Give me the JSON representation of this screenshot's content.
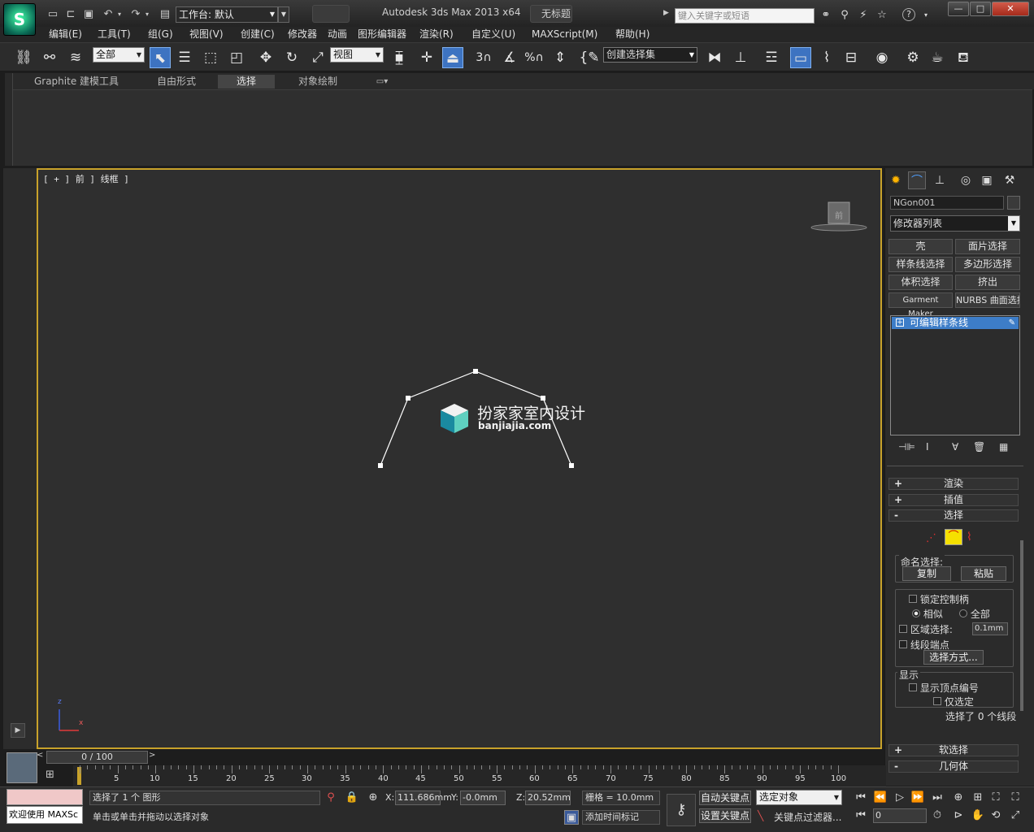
{
  "titlebar": {
    "workspace": "工作台: 默认",
    "app_title": "Autodesk 3ds Max  2013 x64",
    "file_title": "无标题",
    "search_placeholder": "键入关键字或短语",
    "min_label": "—",
    "max_label": "□",
    "close_label": "✕"
  },
  "menubar": {
    "items": [
      "编辑(E)",
      "工具(T)",
      "组(G)",
      "视图(V)",
      "创建(C)",
      "修改器",
      "动画",
      "图形编辑器",
      "渲染(R)",
      "自定义(U)",
      "MAXScript(M)",
      "帮助(H)"
    ]
  },
  "toolbar": {
    "filter_select": "全部",
    "ref_coord": "视图",
    "named_selection": "创建选择集"
  },
  "ribbon": {
    "tabs": [
      "Graphite 建模工具",
      "自由形式",
      "选择",
      "对象绘制"
    ],
    "active_tab": "选择"
  },
  "viewport": {
    "label": "[ + ] 前 ] 线框 ]",
    "viewcube_label": "前",
    "watermark_title": "扮家家室内设计",
    "watermark_url": "banjiajia.com",
    "axis_z": "z",
    "axis_x": "x"
  },
  "command_panel": {
    "object_name": "NGon001",
    "modifier_list": "修改器列表",
    "modifier_buttons": [
      [
        "壳",
        "面片选择"
      ],
      [
        "样条线选择",
        "多边形选择"
      ],
      [
        "体积选择",
        "挤出"
      ],
      [
        "Garment Maker",
        "NURBS 曲面选择"
      ]
    ],
    "stack_item": "可编辑样条线",
    "rollouts": {
      "render": "渲染",
      "interp": "插值",
      "selection": "选择",
      "soft_sel": "软选择",
      "geometry": "几何体"
    },
    "named_sel_label": "命名选择:",
    "copy": "复制",
    "paste": "粘贴",
    "lock_handles": "锁定控制柄",
    "similar": "相似",
    "all": "全部",
    "area_sel": "区域选择:",
    "area_val": "0.1mm",
    "seg_end": "线段端点",
    "select_by": "选择方式...",
    "display": "显示",
    "show_vert_num": "显示顶点编号",
    "selected_only": "仅选定",
    "sel_status": "选择了 0 个线段"
  },
  "timeline": {
    "frame": "0 / 100",
    "ticks": [
      "5",
      "10",
      "15",
      "20",
      "25",
      "30",
      "35",
      "40",
      "45",
      "50",
      "55",
      "60",
      "65",
      "70",
      "75",
      "80",
      "85",
      "90",
      "95",
      "100"
    ]
  },
  "status": {
    "welcome": "欢迎使用  MAXSc",
    "selection": "选择了 1 个 图形",
    "prompt": "单击或单击并拖动以选择对象",
    "x_label": "X:",
    "x_val": "111.686mm",
    "y_label": "Y:",
    "y_val": "-0.0mm",
    "z_label": "Z:",
    "z_val": "20.52mm",
    "grid": "栅格 = 10.0mm",
    "add_time_tag": "添加时间标记",
    "auto_key": "自动关键点",
    "set_key": "设置关键点",
    "key_mode": "选定对象",
    "key_filters": "关键点过滤器...",
    "cur_frame": "0"
  },
  "colors": {
    "viewport_border": "#c8a22a",
    "accent_blue": "#3d7dc8",
    "spline_white": "#ffffff"
  }
}
